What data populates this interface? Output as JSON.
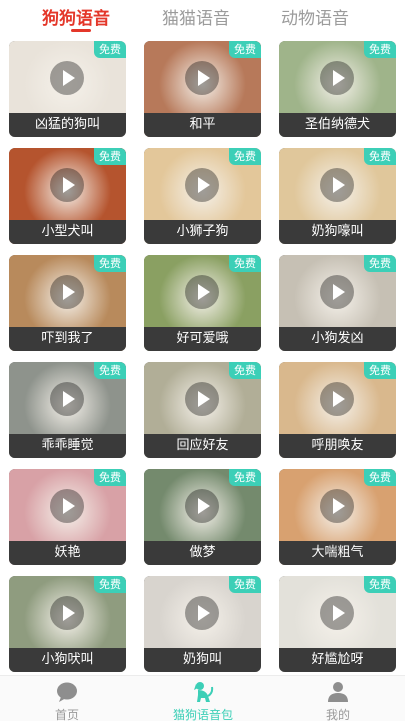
{
  "tabs": [
    {
      "label": "狗狗语音",
      "active": true
    },
    {
      "label": "猫猫语音",
      "active": false
    },
    {
      "label": "动物语音",
      "active": false
    }
  ],
  "badge_text": "免费",
  "cards": [
    {
      "label": "凶猛的狗叫",
      "color": "#e9e3da"
    },
    {
      "label": "和平",
      "color": "#b7795a"
    },
    {
      "label": "圣伯纳德犬",
      "color": "#9fb48a"
    },
    {
      "label": "小型犬叫",
      "color": "#b5542e"
    },
    {
      "label": "小狮子狗",
      "color": "#e3c79a"
    },
    {
      "label": "奶狗嚎叫",
      "color": "#e0c79b"
    },
    {
      "label": "吓到我了",
      "color": "#b88a5c"
    },
    {
      "label": "好可爱哦",
      "color": "#8aa062"
    },
    {
      "label": "小狗发凶",
      "color": "#c6c0b4"
    },
    {
      "label": "乖乖睡觉",
      "color": "#8e938c"
    },
    {
      "label": "回应好友",
      "color": "#b1ae97"
    },
    {
      "label": "呼朋唤友",
      "color": "#d9b88d"
    },
    {
      "label": "妖艳",
      "color": "#d8a1a6"
    },
    {
      "label": "做梦",
      "color": "#748a6d"
    },
    {
      "label": "大喘粗气",
      "color": "#d8a170"
    },
    {
      "label": "小狗吠叫",
      "color": "#8f9c7f"
    },
    {
      "label": "奶狗叫",
      "color": "#d8d4ce"
    },
    {
      "label": "好尴尬呀",
      "color": "#e3e1da"
    }
  ],
  "bottom_nav": [
    {
      "label": "首页",
      "icon": "chat-bubble-icon",
      "active": false
    },
    {
      "label": "猫狗语音包",
      "icon": "dog-icon",
      "active": true
    },
    {
      "label": "我的",
      "icon": "user-icon",
      "active": false
    }
  ],
  "colors": {
    "accent_red": "#e4372a",
    "accent_teal": "#3ccfb7"
  }
}
